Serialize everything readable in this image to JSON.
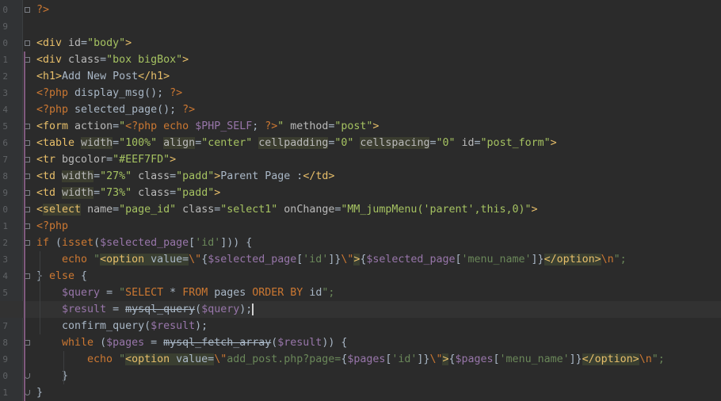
{
  "gutter": {
    "numbers": [
      "0",
      "9",
      "0",
      "1",
      "2",
      "3",
      "4",
      "5",
      "6",
      "7",
      "8",
      "9",
      "0",
      "1",
      "2",
      "3",
      "4",
      "5",
      "6",
      "7",
      "8",
      "9",
      "0",
      "1"
    ]
  },
  "code": {
    "lines": [
      {
        "segs": [
          {
            "t": "?>",
            "c": "php"
          }
        ]
      },
      {
        "segs": []
      },
      {
        "segs": [
          {
            "t": "<div ",
            "c": "tag"
          },
          {
            "t": "id",
            "c": "attr"
          },
          {
            "t": "=",
            "c": "txt"
          },
          {
            "t": "\"body\"",
            "c": "val"
          },
          {
            "t": ">",
            "c": "tag"
          }
        ]
      },
      {
        "segs": [
          {
            "t": "<div ",
            "c": "tag"
          },
          {
            "t": "class",
            "c": "attr"
          },
          {
            "t": "=",
            "c": "txt"
          },
          {
            "t": "\"box bigBox\"",
            "c": "val"
          },
          {
            "t": ">",
            "c": "tag"
          }
        ]
      },
      {
        "segs": [
          {
            "t": "<h1>",
            "c": "tag"
          },
          {
            "t": "Add New Post",
            "c": "txt"
          },
          {
            "t": "</h1>",
            "c": "tag"
          }
        ]
      },
      {
        "segs": [
          {
            "t": "<?php ",
            "c": "php"
          },
          {
            "t": "display_msg(); ",
            "c": "fn"
          },
          {
            "t": "?>",
            "c": "php"
          }
        ]
      },
      {
        "segs": [
          {
            "t": "<?php ",
            "c": "php"
          },
          {
            "t": "selected_page(); ",
            "c": "fn"
          },
          {
            "t": "?>",
            "c": "php"
          }
        ]
      },
      {
        "segs": [
          {
            "t": "<form ",
            "c": "tag"
          },
          {
            "t": "action",
            "c": "attr"
          },
          {
            "t": "=",
            "c": "txt"
          },
          {
            "t": "\"",
            "c": "val"
          },
          {
            "t": "<?php echo ",
            "c": "php"
          },
          {
            "t": "$PHP_SELF",
            "c": "var"
          },
          {
            "t": "; ",
            "c": "txt"
          },
          {
            "t": "?>",
            "c": "php"
          },
          {
            "t": "\"",
            "c": "val"
          },
          {
            "t": " method",
            "c": "attr"
          },
          {
            "t": "=",
            "c": "txt"
          },
          {
            "t": "\"post\"",
            "c": "val"
          },
          {
            "t": ">",
            "c": "tag"
          }
        ]
      },
      {
        "segs": [
          {
            "t": "<table ",
            "c": "tag"
          },
          {
            "t": "width",
            "c": "attr hl"
          },
          {
            "t": "=",
            "c": "txt"
          },
          {
            "t": "\"100%\"",
            "c": "val"
          },
          {
            "t": " ",
            "c": "txt"
          },
          {
            "t": "align",
            "c": "attr hl"
          },
          {
            "t": "=",
            "c": "txt"
          },
          {
            "t": "\"center\"",
            "c": "val"
          },
          {
            "t": " ",
            "c": "txt"
          },
          {
            "t": "cellpadding",
            "c": "attr hl"
          },
          {
            "t": "=",
            "c": "txt"
          },
          {
            "t": "\"0\"",
            "c": "val"
          },
          {
            "t": " ",
            "c": "txt"
          },
          {
            "t": "cellspacing",
            "c": "attr hl"
          },
          {
            "t": "=",
            "c": "txt"
          },
          {
            "t": "\"0\"",
            "c": "val"
          },
          {
            "t": " id",
            "c": "attr"
          },
          {
            "t": "=",
            "c": "txt"
          },
          {
            "t": "\"post_form\"",
            "c": "val"
          },
          {
            "t": ">",
            "c": "tag"
          }
        ]
      },
      {
        "segs": [
          {
            "t": "<tr ",
            "c": "tag"
          },
          {
            "t": "bgcolor",
            "c": "attr"
          },
          {
            "t": "=",
            "c": "txt"
          },
          {
            "t": "\"#EEF7FD\"",
            "c": "val"
          },
          {
            "t": ">",
            "c": "tag"
          }
        ]
      },
      {
        "segs": [
          {
            "t": "<td ",
            "c": "tag"
          },
          {
            "t": "width",
            "c": "attr hl"
          },
          {
            "t": "=",
            "c": "txt"
          },
          {
            "t": "\"27%\"",
            "c": "val"
          },
          {
            "t": " class",
            "c": "attr"
          },
          {
            "t": "=",
            "c": "txt"
          },
          {
            "t": "\"padd\"",
            "c": "val"
          },
          {
            "t": ">",
            "c": "tag"
          },
          {
            "t": "Parent Page :",
            "c": "txt"
          },
          {
            "t": "</td>",
            "c": "tag"
          }
        ]
      },
      {
        "segs": [
          {
            "t": "<td ",
            "c": "tag"
          },
          {
            "t": "width",
            "c": "attr hl"
          },
          {
            "t": "=",
            "c": "txt"
          },
          {
            "t": "\"73%\"",
            "c": "val"
          },
          {
            "t": " class",
            "c": "attr"
          },
          {
            "t": "=",
            "c": "txt"
          },
          {
            "t": "\"padd\"",
            "c": "val"
          },
          {
            "t": ">",
            "c": "tag"
          }
        ]
      },
      {
        "segs": [
          {
            "t": "<",
            "c": "tag"
          },
          {
            "t": "select",
            "c": "tag hl"
          },
          {
            "t": " name",
            "c": "attr"
          },
          {
            "t": "=",
            "c": "txt"
          },
          {
            "t": "\"page_id\"",
            "c": "val"
          },
          {
            "t": " class",
            "c": "attr"
          },
          {
            "t": "=",
            "c": "txt"
          },
          {
            "t": "\"select1\"",
            "c": "val"
          },
          {
            "t": " onChange",
            "c": "attr"
          },
          {
            "t": "=",
            "c": "txt"
          },
          {
            "t": "\"MM_jumpMenu('parent',this,0)\"",
            "c": "val"
          },
          {
            "t": ">",
            "c": "tag"
          }
        ]
      },
      {
        "segs": [
          {
            "t": "<?php",
            "c": "php"
          }
        ]
      },
      {
        "segs": [
          {
            "t": "if ",
            "c": "kw"
          },
          {
            "t": "(",
            "c": "txt"
          },
          {
            "t": "isset",
            "c": "kw"
          },
          {
            "t": "(",
            "c": "txt"
          },
          {
            "t": "$selected_page",
            "c": "var"
          },
          {
            "t": "[",
            "c": "txt"
          },
          {
            "t": "'id'",
            "c": "str"
          },
          {
            "t": "])) {",
            "c": "txt"
          }
        ]
      },
      {
        "segs": [
          {
            "t": "    echo ",
            "c": "kw"
          },
          {
            "t": "\"",
            "c": "str"
          },
          {
            "t": "<option ",
            "c": "tag hlb"
          },
          {
            "t": "value=",
            "c": "txt hlb"
          },
          {
            "t": "\\\"",
            "c": "esc"
          },
          {
            "t": "{",
            "c": "txt"
          },
          {
            "t": "$selected_page",
            "c": "var"
          },
          {
            "t": "[",
            "c": "txt"
          },
          {
            "t": "'id'",
            "c": "str"
          },
          {
            "t": "]}",
            "c": "txt"
          },
          {
            "t": "\\\"",
            "c": "esc"
          },
          {
            "t": ">",
            "c": "tag hlb"
          },
          {
            "t": "{",
            "c": "txt"
          },
          {
            "t": "$selected_page",
            "c": "var"
          },
          {
            "t": "[",
            "c": "txt"
          },
          {
            "t": "'menu_name'",
            "c": "str"
          },
          {
            "t": "]}",
            "c": "txt"
          },
          {
            "t": "</option>",
            "c": "tag hlb"
          },
          {
            "t": "\\n",
            "c": "esc"
          },
          {
            "t": "\";",
            "c": "str"
          }
        ]
      },
      {
        "segs": [
          {
            "t": "} ",
            "c": "txt"
          },
          {
            "t": "else ",
            "c": "kw"
          },
          {
            "t": "{",
            "c": "txt"
          }
        ]
      },
      {
        "segs": [
          {
            "t": "    ",
            "c": "txt"
          },
          {
            "t": "$query",
            "c": "var"
          },
          {
            "t": " = ",
            "c": "txt"
          },
          {
            "t": "\"",
            "c": "str"
          },
          {
            "t": "SELECT ",
            "c": "kw"
          },
          {
            "t": "* ",
            "c": "txt"
          },
          {
            "t": "FROM ",
            "c": "kw"
          },
          {
            "t": "pages ",
            "c": "txt"
          },
          {
            "t": "ORDER BY ",
            "c": "kw"
          },
          {
            "t": "id",
            "c": "txt"
          },
          {
            "t": "\";",
            "c": "str"
          }
        ]
      },
      {
        "segs": [
          {
            "t": "    ",
            "c": "txt"
          },
          {
            "t": "$result",
            "c": "var"
          },
          {
            "t": " = ",
            "c": "txt"
          },
          {
            "t": "mysql_query",
            "c": "fn strike"
          },
          {
            "t": "(",
            "c": "txt"
          },
          {
            "t": "$query",
            "c": "var"
          },
          {
            "t": ");",
            "c": "txt"
          }
        ],
        "cur": true
      },
      {
        "segs": [
          {
            "t": "    confirm_query(",
            "c": "fn"
          },
          {
            "t": "$result",
            "c": "var"
          },
          {
            "t": ");",
            "c": "txt"
          }
        ]
      },
      {
        "segs": [
          {
            "t": "    while ",
            "c": "kw"
          },
          {
            "t": "(",
            "c": "txt"
          },
          {
            "t": "$pages",
            "c": "var"
          },
          {
            "t": " = ",
            "c": "txt"
          },
          {
            "t": "mysql_fetch_array",
            "c": "fn strike"
          },
          {
            "t": "(",
            "c": "txt"
          },
          {
            "t": "$result",
            "c": "var"
          },
          {
            "t": ")) {",
            "c": "txt"
          }
        ]
      },
      {
        "segs": [
          {
            "t": "        echo ",
            "c": "kw"
          },
          {
            "t": "\"",
            "c": "str"
          },
          {
            "t": "<option ",
            "c": "tag hlb"
          },
          {
            "t": "value=",
            "c": "txt hlb"
          },
          {
            "t": "\\\"",
            "c": "esc"
          },
          {
            "t": "add_post.php?page=",
            "c": "str"
          },
          {
            "t": "{",
            "c": "txt"
          },
          {
            "t": "$pages",
            "c": "var"
          },
          {
            "t": "[",
            "c": "txt"
          },
          {
            "t": "'id'",
            "c": "str"
          },
          {
            "t": "]}",
            "c": "txt"
          },
          {
            "t": "\\\"",
            "c": "esc"
          },
          {
            "t": ">",
            "c": "tag hlb"
          },
          {
            "t": "{",
            "c": "txt"
          },
          {
            "t": "$pages",
            "c": "var"
          },
          {
            "t": "[",
            "c": "txt"
          },
          {
            "t": "'menu_name'",
            "c": "str"
          },
          {
            "t": "]}",
            "c": "txt"
          },
          {
            "t": "</option>",
            "c": "tag hlb"
          },
          {
            "t": "\\n",
            "c": "esc"
          },
          {
            "t": "\";",
            "c": "str"
          }
        ]
      },
      {
        "segs": [
          {
            "t": "    }",
            "c": "txt"
          }
        ]
      },
      {
        "segs": [
          {
            "t": "}",
            "c": "txt"
          }
        ]
      }
    ]
  }
}
